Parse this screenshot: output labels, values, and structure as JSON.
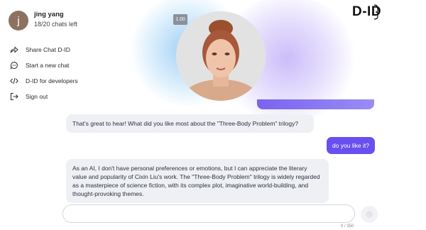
{
  "user": {
    "initial": "j",
    "name": "jing yang",
    "chats_left": "18/20 chats left"
  },
  "menu": [
    {
      "label": "Share Chat D-ID",
      "icon": "share-icon"
    },
    {
      "label": "Start a new chat",
      "icon": "chat-bubble-icon"
    },
    {
      "label": "D-ID for developers",
      "icon": "code-icon"
    },
    {
      "label": "Sign out",
      "icon": "sign-out-icon"
    }
  ],
  "logo": {
    "text": "D-ID"
  },
  "video": {
    "speed": "1.00"
  },
  "messages": {
    "ai_1": "That's great to hear! What did you like most about the \"Three-Body Problem\" trilogy?",
    "user_1": "do you like it?",
    "ai_2": "As an AI, I don't have personal preferences or emotions, but I can appreciate the literary value and popularity of Cixin Liu's work. The \"Three-Body Problem\" trilogy is widely regarded as a masterpiece of science fiction, with its complex plot, imaginative world-building, and thought-provoking themes."
  },
  "composer": {
    "placeholder": "",
    "char_count": "0 / 350"
  },
  "colors": {
    "accent": "#6a4ff0",
    "bubble_bg": "#eef0f4"
  }
}
